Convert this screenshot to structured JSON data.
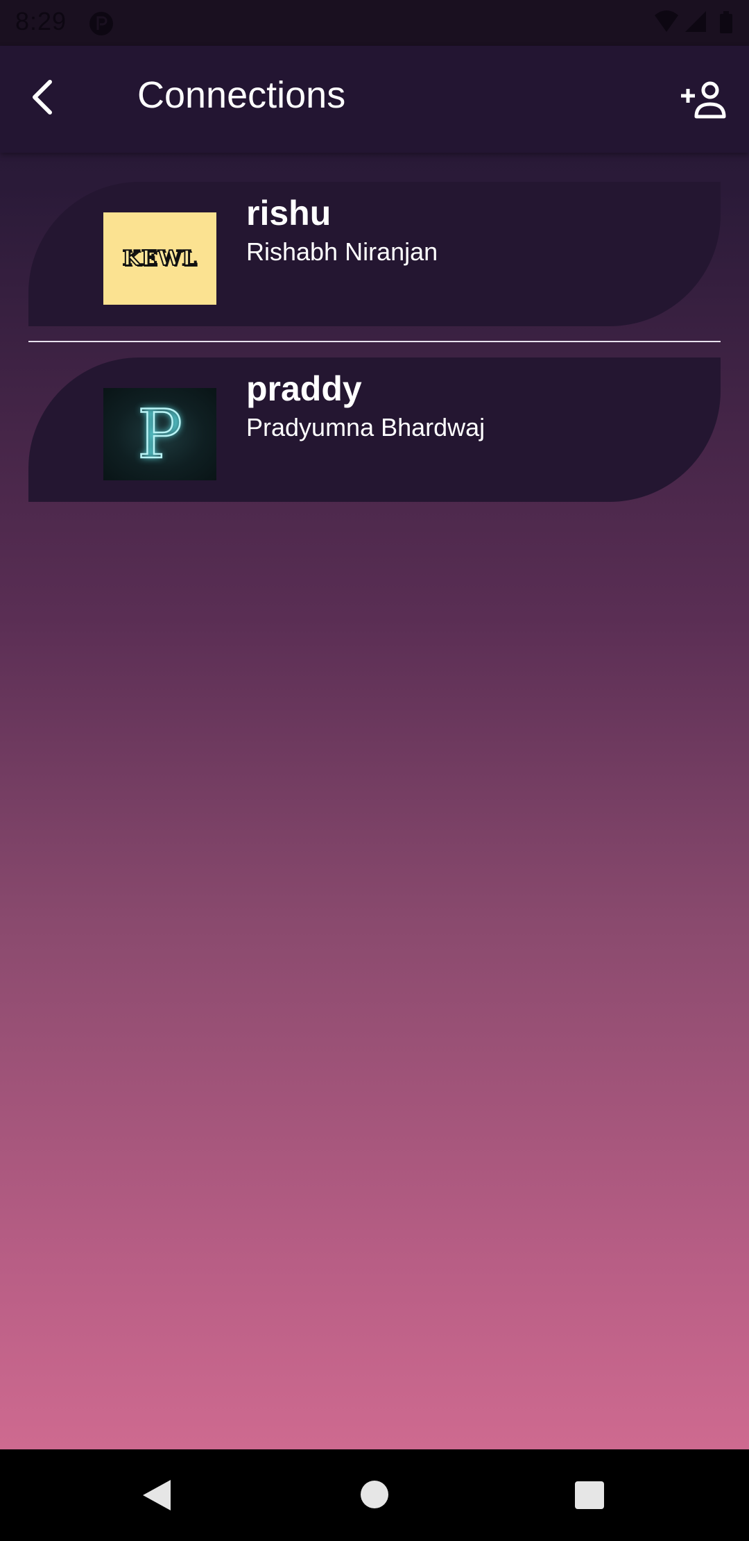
{
  "status_bar": {
    "time": "8:29",
    "icons": [
      "p-app-icon",
      "wifi-icon",
      "cell-signal-icon",
      "battery-icon"
    ]
  },
  "app_bar": {
    "title": "Connections",
    "back_icon": "chevron-left-icon",
    "action_icon": "add-person-icon"
  },
  "connections": [
    {
      "username": "rishu",
      "full_name": "Rishabh Niranjan",
      "avatar_text": "KEWL",
      "avatar_bg": "#fbe291"
    },
    {
      "username": "praddy",
      "full_name": "Pradyumna Bhardwaj",
      "avatar_text": "P",
      "avatar_bg": "#0f1f22"
    }
  ],
  "nav_bar": {
    "icons": [
      "nav-back-icon",
      "nav-home-icon",
      "nav-recents-icon"
    ]
  },
  "colors": {
    "app_bar_bg": "#231532",
    "card_bg": "#241631",
    "gradient_top": "#231531",
    "gradient_bottom": "#d97095"
  }
}
